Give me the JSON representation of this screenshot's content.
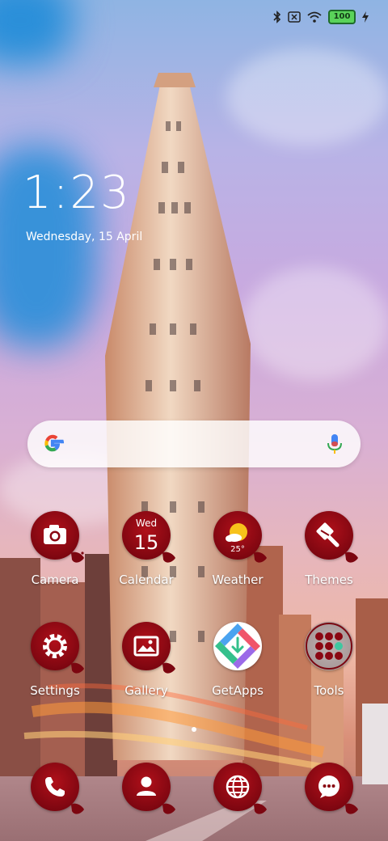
{
  "status_bar": {
    "battery": "100",
    "icons": [
      "bluetooth-icon",
      "no-sim-icon",
      "wifi-icon",
      "battery-icon",
      "charging-icon"
    ]
  },
  "lockwidget": {
    "time": "1:23",
    "date": "Wednesday, 15 April"
  },
  "search_bar": {
    "icons": [
      "google-g-icon",
      "microphone-icon"
    ]
  },
  "apps_row1": [
    {
      "label": "Camera",
      "icon": "camera-icon"
    },
    {
      "label": "Calendar",
      "icon": "calendar-icon",
      "day": "Wed",
      "date": "15"
    },
    {
      "label": "Weather",
      "icon": "weather-icon",
      "temp": "25°"
    },
    {
      "label": "Themes",
      "icon": "paintbrush-icon"
    }
  ],
  "apps_row2": [
    {
      "label": "Settings",
      "icon": "gear-icon"
    },
    {
      "label": "Gallery",
      "icon": "picture-icon"
    },
    {
      "label": "GetApps",
      "icon": "getapps-icon"
    },
    {
      "label": "Tools",
      "icon": "tools-folder-icon"
    }
  ],
  "page_indicator": {
    "pages": 1,
    "current": 1
  },
  "dock": [
    {
      "icon": "phone-icon"
    },
    {
      "icon": "contacts-icon"
    },
    {
      "icon": "browser-icon"
    },
    {
      "icon": "messages-icon"
    }
  ],
  "colors": {
    "icon_red": "#8a0712",
    "label": "#ffffff"
  }
}
